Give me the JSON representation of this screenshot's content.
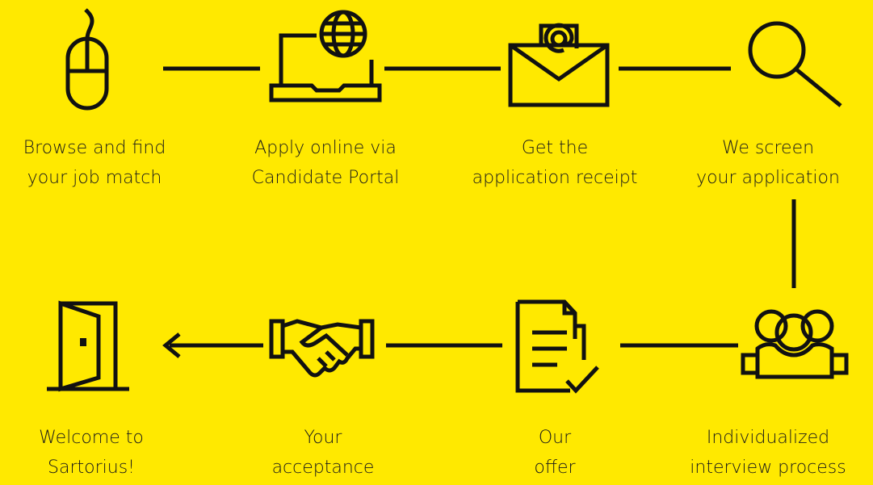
{
  "colors": {
    "background": "#FFE900",
    "ink": "#111111"
  },
  "steps": [
    {
      "icon": "computer-mouse-icon",
      "lines": [
        "Browse and find",
        "your job match"
      ]
    },
    {
      "icon": "laptop-globe-icon",
      "lines": [
        "Apply online via",
        "Candidate Portal"
      ]
    },
    {
      "icon": "email-envelope-icon",
      "lines": [
        "Get the",
        "application receipt"
      ]
    },
    {
      "icon": "magnifier-search-icon",
      "lines": [
        "We screen",
        "your application"
      ]
    },
    {
      "icon": "people-group-icon",
      "lines": [
        "Individualized",
        "interview process"
      ]
    },
    {
      "icon": "document-check-icon",
      "lines": [
        "Our",
        "offer"
      ]
    },
    {
      "icon": "handshake-icon",
      "lines": [
        "Your",
        "acceptance"
      ]
    },
    {
      "icon": "open-door-icon",
      "lines": [
        "Welcome to",
        "Sartorius!"
      ]
    }
  ]
}
